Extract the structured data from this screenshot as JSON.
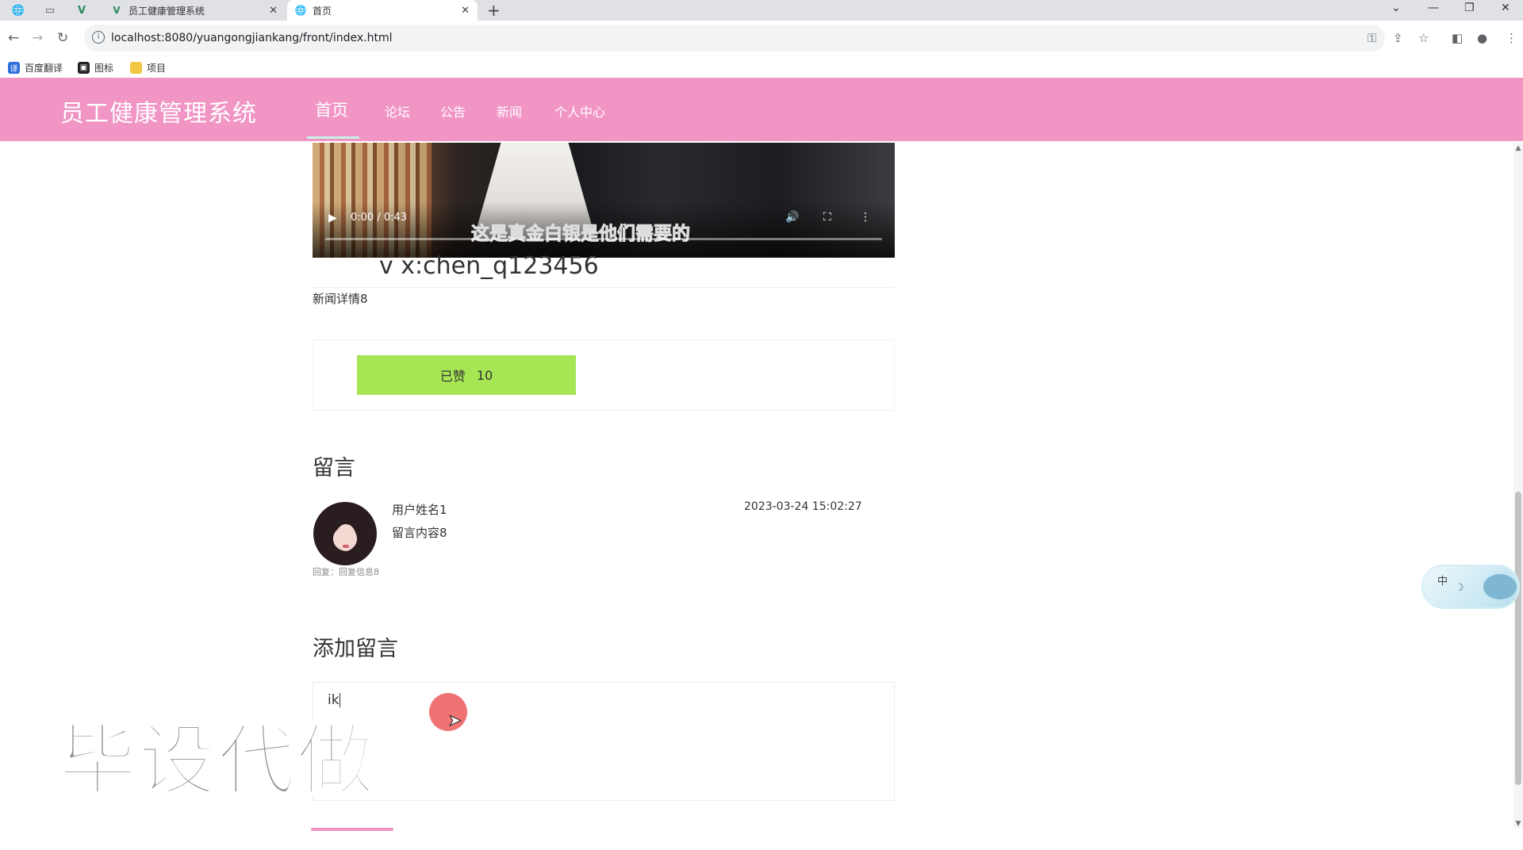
{
  "browser": {
    "tabs": [
      {
        "label": "员工健康管理系统",
        "active": false
      },
      {
        "label": "首页",
        "active": true
      }
    ],
    "url": "localhost:8080/yuangongjiankang/front/index.html",
    "bookmarks": [
      "百度翻译",
      "图标",
      "项目"
    ]
  },
  "site": {
    "title": "员工健康管理系统",
    "nav": [
      "首页",
      "论坛",
      "公告",
      "新闻",
      "个人中心"
    ]
  },
  "video": {
    "time": "0:00 / 0:43",
    "subtitle": "这是真金白银是他们需要的"
  },
  "news": {
    "wechat": "v x:chen_q123456",
    "detail": "新闻详情8",
    "like_label": "已赞",
    "like_count": "10"
  },
  "comments": {
    "title": "留言",
    "items": [
      {
        "user": "用户姓名1",
        "content": "留言内容8",
        "date": "2023-03-24 15:02:27",
        "reply": "回复：回复信息8"
      }
    ]
  },
  "add_comment": {
    "title": "添加留言",
    "value": "ik"
  },
  "overlay": {
    "watermark": "毕设代做",
    "widget_label": "中"
  },
  "colors": {
    "header": "#f195c5",
    "like_button": "#a6e655"
  }
}
